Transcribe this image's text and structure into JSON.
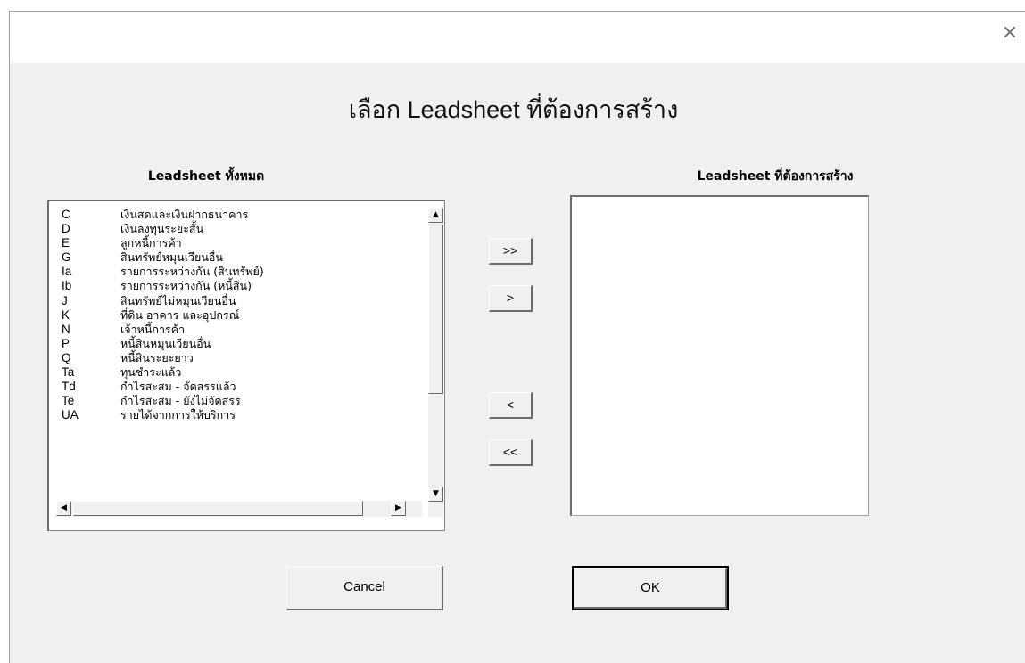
{
  "window": {
    "close_glyph": "✕"
  },
  "dialog": {
    "title": "เลือก Leadsheet ที่ต้องการสร้าง"
  },
  "left_list": {
    "header": "Leadsheet ทั้งหมด",
    "items": [
      {
        "code": "C",
        "label": "เงินสดและเงินฝากธนาคาร"
      },
      {
        "code": "D",
        "label": "เงินลงทุนระยะสั้น"
      },
      {
        "code": "E",
        "label": "ลูกหนี้การค้า"
      },
      {
        "code": "G",
        "label": "สินทรัพย์หมุนเวียนอื่น"
      },
      {
        "code": "Ia",
        "label": "รายการระหว่างกัน (สินทรัพย์)"
      },
      {
        "code": "Ib",
        "label": "รายการระหว่างกัน (หนี้สิน)"
      },
      {
        "code": "J",
        "label": "สินทรัพย์ไม่หมุนเวียนอื่น"
      },
      {
        "code": "K",
        "label": "ที่ดิน อาคาร และอุปกรณ์"
      },
      {
        "code": "N",
        "label": "เจ้าหนี้การค้า"
      },
      {
        "code": "P",
        "label": "หนี้สินหมุนเวียนอื่น"
      },
      {
        "code": "Q",
        "label": "หนี้สินระยะยาว"
      },
      {
        "code": "Ta",
        "label": "ทุนชำระแล้ว"
      },
      {
        "code": "Td",
        "label": "กำไรสะสม - จัดสรรแล้ว"
      },
      {
        "code": "Te",
        "label": "กำไรสะสม - ยังไม่จัดสรร"
      },
      {
        "code": "UA",
        "label": "รายได้จากการให้บริการ"
      }
    ],
    "scroll_up": "▲",
    "scroll_down": "▼",
    "scroll_left": "◀",
    "scroll_right": "▶"
  },
  "right_list": {
    "header": "Leadsheet ที่ต้องการสร้าง",
    "items": []
  },
  "move_buttons": {
    "add_all": ">>",
    "add_one": ">",
    "remove_one": "<",
    "remove_all": "<<"
  },
  "actions": {
    "cancel": "Cancel",
    "ok": "OK"
  }
}
